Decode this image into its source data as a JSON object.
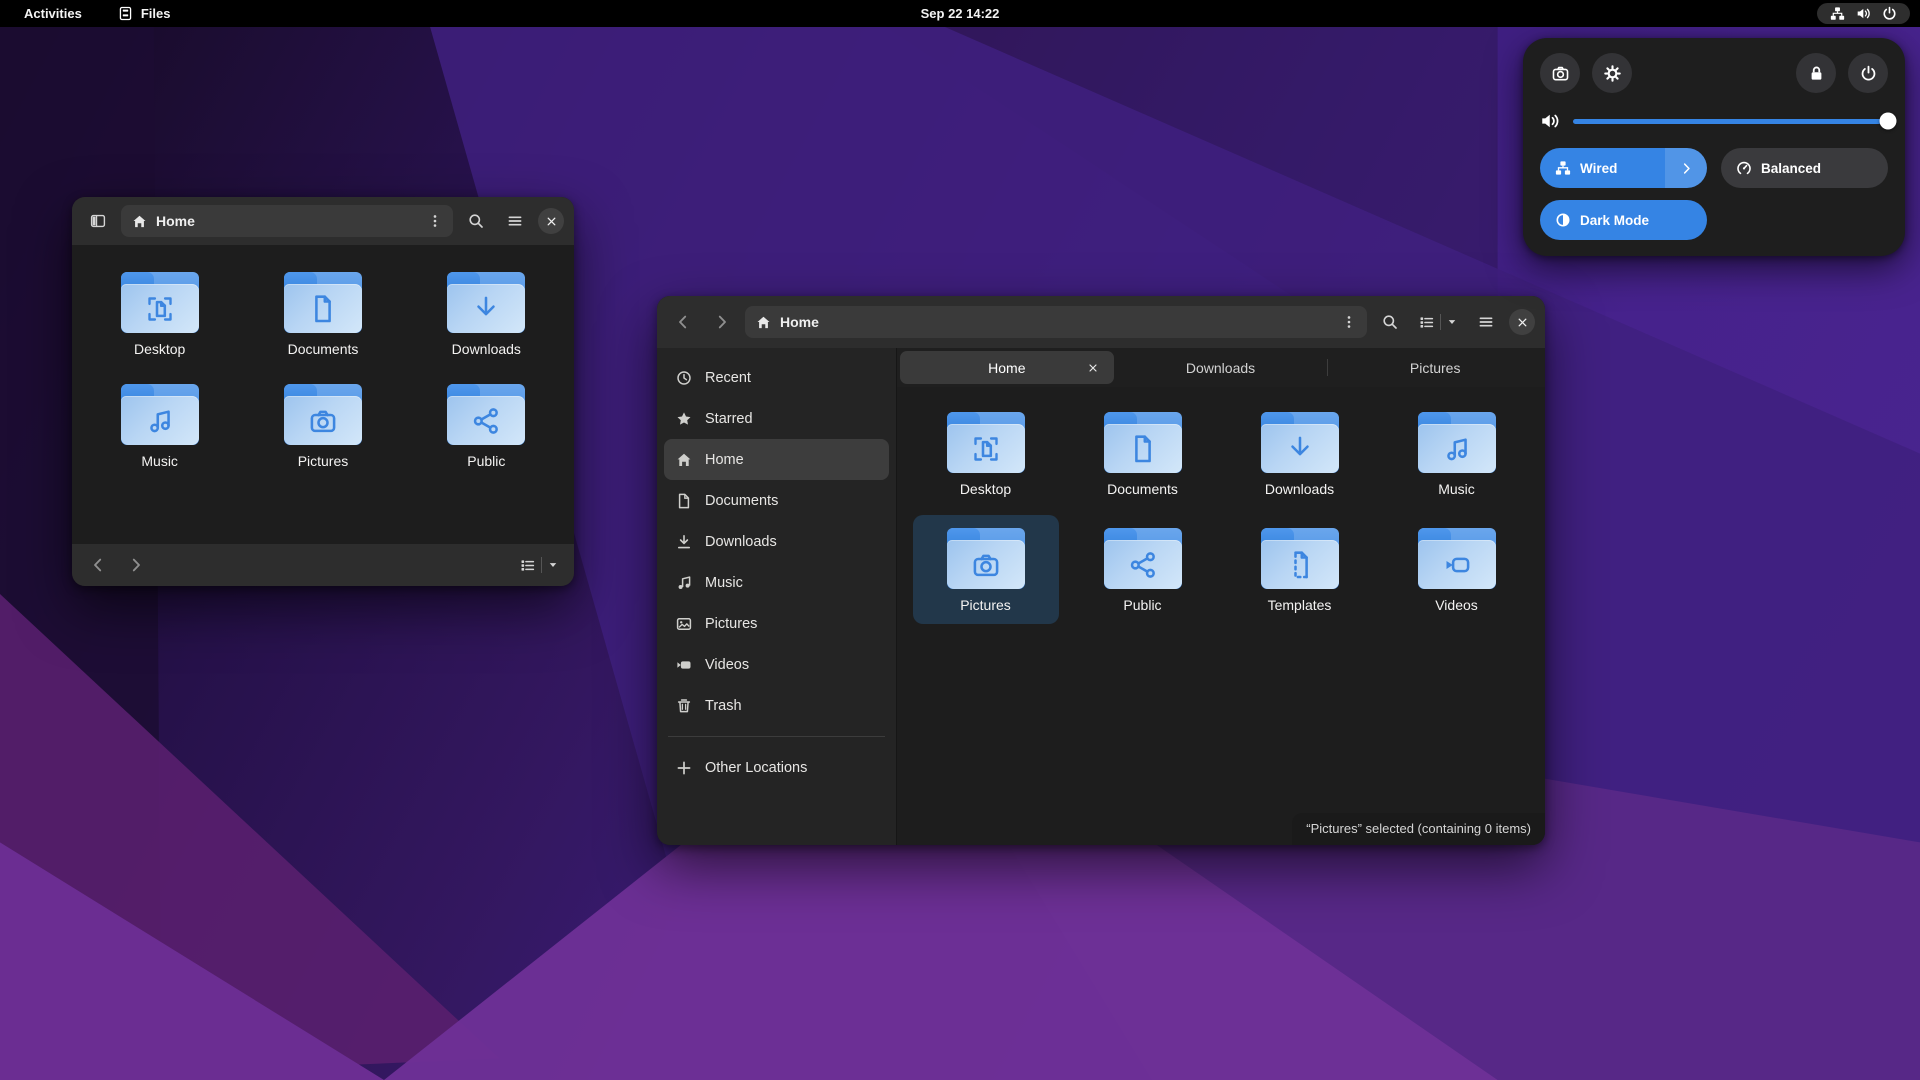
{
  "colors": {
    "accent": "#3584e4",
    "selection_bg": "#22374a",
    "folder_emblem": "#3d86e0"
  },
  "topbar": {
    "activities_label": "Activities",
    "app_menu_label": "Files",
    "app_menu_icon": "files-app-icon",
    "clock": "Sep 22 14:22",
    "tray_icons": [
      "network-wired-icon",
      "volume-icon",
      "power-icon"
    ]
  },
  "quick_settings": {
    "header_buttons_left": [
      {
        "name": "screenshot-button",
        "icon": "camera"
      },
      {
        "name": "settings-button",
        "icon": "gear"
      }
    ],
    "header_buttons_right": [
      {
        "name": "lock-button",
        "icon": "lock"
      },
      {
        "name": "power-button",
        "icon": "power"
      }
    ],
    "volume_slider": {
      "icon": "volume",
      "value_percent": 100
    },
    "toggles": [
      {
        "label": "Wired",
        "icon": "network",
        "active": true,
        "arrow": true
      },
      {
        "label": "Balanced",
        "icon": "speedometer",
        "active": false,
        "arrow": false
      },
      {
        "label": "Dark Mode",
        "icon": "dark-mode",
        "active": true,
        "arrow": false
      }
    ]
  },
  "small_window": {
    "path_label": "Home",
    "folders": [
      {
        "name": "Desktop",
        "emblem": "desktop"
      },
      {
        "name": "Documents",
        "emblem": "documents"
      },
      {
        "name": "Downloads",
        "emblem": "downloads"
      },
      {
        "name": "Music",
        "emblem": "music"
      },
      {
        "name": "Pictures",
        "emblem": "pictures"
      },
      {
        "name": "Public",
        "emblem": "public"
      }
    ]
  },
  "large_window": {
    "path_label": "Home",
    "tabs": [
      {
        "label": "Home",
        "active": true,
        "closable": true
      },
      {
        "label": "Downloads",
        "active": false,
        "closable": false
      },
      {
        "label": "Pictures",
        "active": false,
        "closable": false
      }
    ],
    "sidebar_top": [
      {
        "label": "Recent",
        "icon": "recent",
        "selected": false
      },
      {
        "label": "Starred",
        "icon": "starred",
        "selected": false
      },
      {
        "label": "Home",
        "icon": "home",
        "selected": true
      },
      {
        "label": "Documents",
        "icon": "doc",
        "selected": false
      },
      {
        "label": "Downloads",
        "icon": "download",
        "selected": false
      },
      {
        "label": "Music",
        "icon": "music-note",
        "selected": false
      },
      {
        "label": "Pictures",
        "icon": "image",
        "selected": false
      },
      {
        "label": "Videos",
        "icon": "video",
        "selected": false
      },
      {
        "label": "Trash",
        "icon": "trash",
        "selected": false
      }
    ],
    "sidebar_bottom": [
      {
        "label": "Other Locations",
        "icon": "plus",
        "selected": false
      }
    ],
    "folders": [
      {
        "name": "Desktop",
        "emblem": "desktop",
        "selected": false
      },
      {
        "name": "Documents",
        "emblem": "documents",
        "selected": false
      },
      {
        "name": "Downloads",
        "emblem": "downloads",
        "selected": false
      },
      {
        "name": "Music",
        "emblem": "music",
        "selected": false
      },
      {
        "name": "Pictures",
        "emblem": "pictures",
        "selected": true
      },
      {
        "name": "Public",
        "emblem": "public",
        "selected": false
      },
      {
        "name": "Templates",
        "emblem": "templates",
        "selected": false
      },
      {
        "name": "Videos",
        "emblem": "videos",
        "selected": false
      }
    ],
    "statusbar": "“Pictures” selected (containing 0 items)"
  }
}
